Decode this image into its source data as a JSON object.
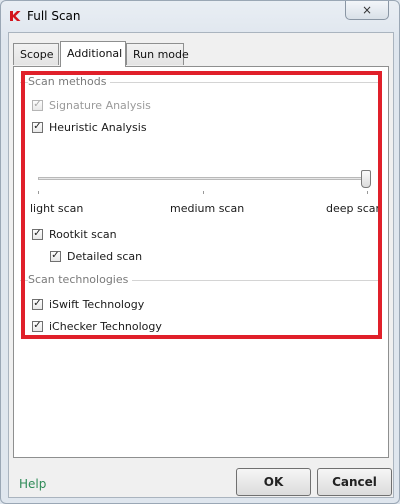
{
  "window": {
    "title": "Full Scan",
    "close_icon": "×"
  },
  "tabs": [
    {
      "label": "Scope"
    },
    {
      "label": "Additional",
      "active": true
    },
    {
      "label": "Run mode"
    }
  ],
  "scan_methods": {
    "title": "Scan methods",
    "signature_analysis": {
      "label": "Signature Analysis",
      "checked": true,
      "disabled": true
    },
    "heuristic_analysis": {
      "label": "Heuristic Analysis",
      "checked": true
    },
    "heuristic_level": {
      "labels": [
        "light scan",
        "medium scan",
        "deep scan"
      ],
      "selected": "deep scan"
    },
    "rootkit_scan": {
      "label": "Rootkit scan",
      "checked": true
    },
    "detailed_scan": {
      "label": "Detailed scan",
      "checked": true
    }
  },
  "scan_technologies": {
    "title": "Scan technologies",
    "iswift": {
      "label": "iSwift Technology",
      "checked": true
    },
    "ichecker": {
      "label": "iChecker Technology",
      "checked": true
    }
  },
  "footer": {
    "help": "Help",
    "ok": "OK",
    "cancel": "Cancel"
  },
  "colors": {
    "highlight": "#e0202a",
    "help_link": "#2e8b57",
    "brand": "#d3141c"
  },
  "icons": {
    "app": "kaspersky-k-icon",
    "check": "✓"
  }
}
